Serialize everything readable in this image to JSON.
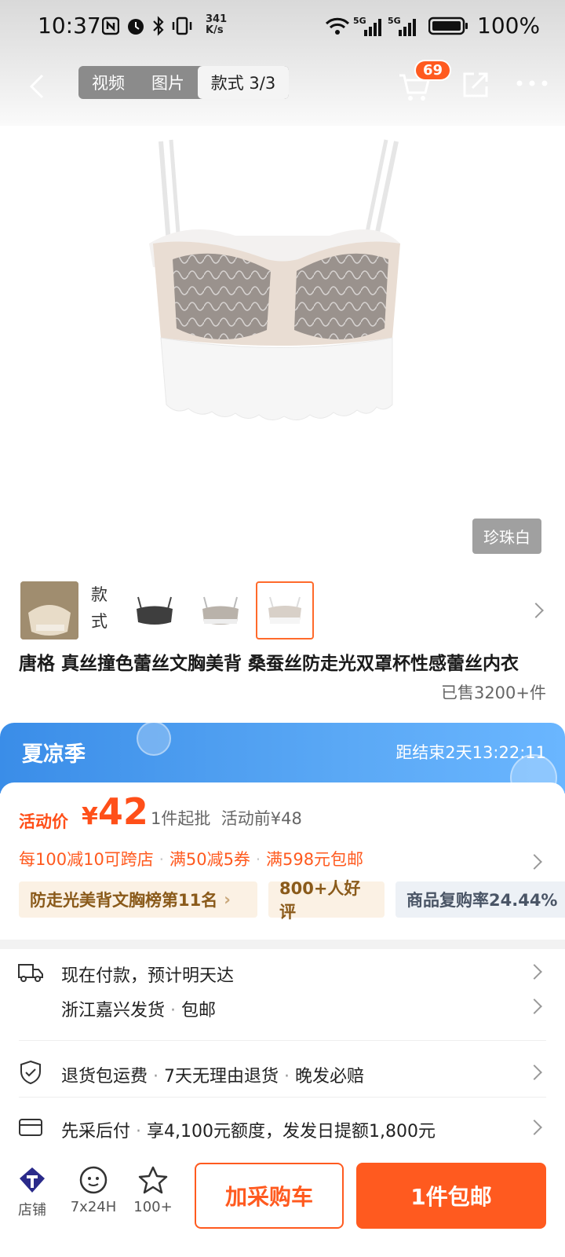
{
  "status": {
    "time": "10:37",
    "net_speed_value": "341",
    "net_speed_unit": "K/s",
    "battery": "100%"
  },
  "header": {
    "tabs": [
      "视频",
      "图片",
      "款式 3/3"
    ],
    "cart_badge": "69"
  },
  "gallery": {
    "color_tag": "珍珠白",
    "style_label": "款式"
  },
  "product": {
    "title": "唐格 真丝撞色蕾丝文胸美背 桑蚕丝防走光双罩杯性感蕾丝内衣",
    "sold": "已售3200+件"
  },
  "promo": {
    "title": "夏凉季",
    "countdown": "距结束2天13:22:11"
  },
  "price": {
    "label": "活动价",
    "currency": "¥",
    "value": "42",
    "min_order": "1件起批",
    "before": "活动前¥48",
    "coupons": [
      "每100减10可跨店",
      "满50减5券",
      "满598元包邮"
    ],
    "tags": [
      "防走光美背文胸榜第11名",
      "800+人好评",
      "商品复购率24.44%"
    ]
  },
  "service": {
    "delivery": "现在付款，预计明天达",
    "ship_from": "浙江嘉兴发货",
    "ship_free": "包邮",
    "returns": [
      "退货包运费",
      "7天无理由退货",
      "晚发必赔"
    ],
    "credit_a": "先采后付",
    "credit_b": "享4,100元额度，发发日提额1,800元"
  },
  "bottom": {
    "shop": "店铺",
    "service": "7x24H",
    "fav": "100+",
    "add_cart": "加采购车",
    "buy": "1件包邮"
  },
  "colors": {
    "accent": "#ff5a1f",
    "banner": "#4a9af0"
  }
}
